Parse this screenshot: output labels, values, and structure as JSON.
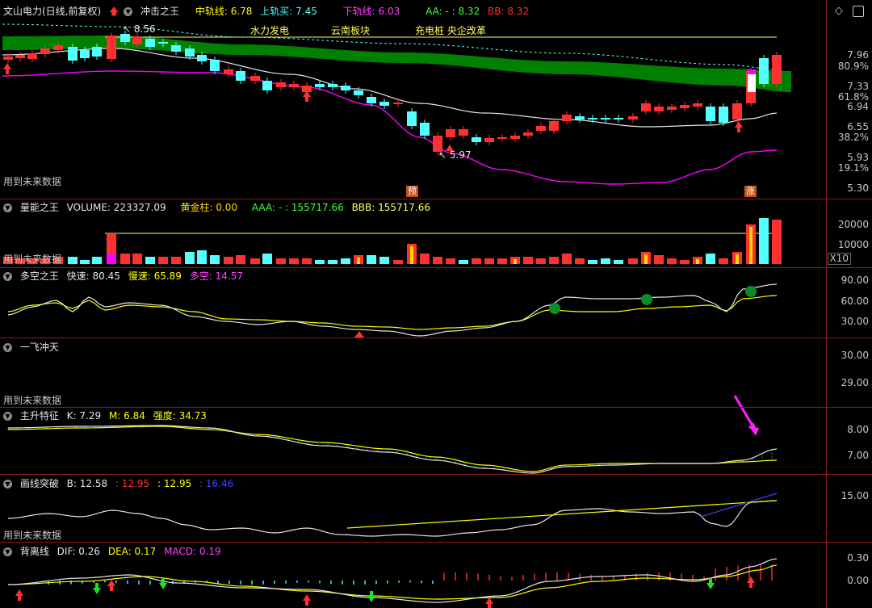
{
  "title": {
    "stock": "文山电力(日线,前复权)",
    "indicator": "冲击之王"
  },
  "main": {
    "mid_label": "中轨线: 6.78",
    "upper_buy_label": "上轨买: 7.45",
    "lower_label": "下轨线: 6.03",
    "aa_label": "AA: - : 8.32",
    "bb_label": "BB: 8.32",
    "concepts": [
      "水力发电",
      "云南板块",
      "充电桩 央企改革"
    ],
    "high_label": "8.56",
    "low_label": "5.97",
    "future_text": "用到未来数据",
    "tag_pre": "预",
    "tag_up": "涨",
    "price_axis": [
      "7.96",
      "80.9%",
      "7.33",
      "61.8%",
      "6.94",
      "6.55",
      "38.2%",
      "5.93",
      "19.1%",
      "5.30"
    ]
  },
  "volume": {
    "name": "量能之王",
    "volume_label": "VOLUME: 223327.09",
    "gold_label": "黄金柱: 0.00",
    "aaa_label": "AAA: - : 155717.66",
    "bbb_label": "BBB: 155717.66",
    "future_text": "用到未来数据",
    "axis": [
      "20000",
      "10000",
      "X10"
    ]
  },
  "duokong": {
    "name": "多空之王",
    "fast_label": "快速: 80.45",
    "slow_label": "慢速: 65.89",
    "dk_label": "多空: 14.57",
    "axis": [
      "90.00",
      "60.00",
      "30.00"
    ],
    "marker": "空"
  },
  "yifei": {
    "name": "一飞冲天",
    "future_text": "用到未来数据",
    "axis": [
      "30.00",
      "29.00"
    ]
  },
  "zhusheng": {
    "name": "主升特征",
    "k_label": "K: 7.29",
    "m_label": "M: 6.84",
    "strength_label": "强度: 34.73",
    "axis": [
      "8.00",
      "7.00"
    ]
  },
  "huaxian": {
    "name": "画线突破",
    "b_label": "B: 12.58",
    "v1": ": 12.95",
    "v2": ": 12.95",
    "v3": ": 16.46",
    "future_text": "用到未来数据",
    "axis": [
      "15.00"
    ]
  },
  "macd": {
    "name": "背离线",
    "dif_label": "DIF: 0.26",
    "dea_label": "DEA: 0.17",
    "macd_label": "MACD: 0.19",
    "axis": [
      "0.30",
      "0.00"
    ]
  },
  "colors": {
    "up": "#ff3030",
    "down": "#54ffff",
    "cloud": "#008000",
    "magenta": "#ff00ff",
    "yellow": "#ffff00",
    "white": "#e6e6e6",
    "separator": "#8a1c1c"
  }
}
